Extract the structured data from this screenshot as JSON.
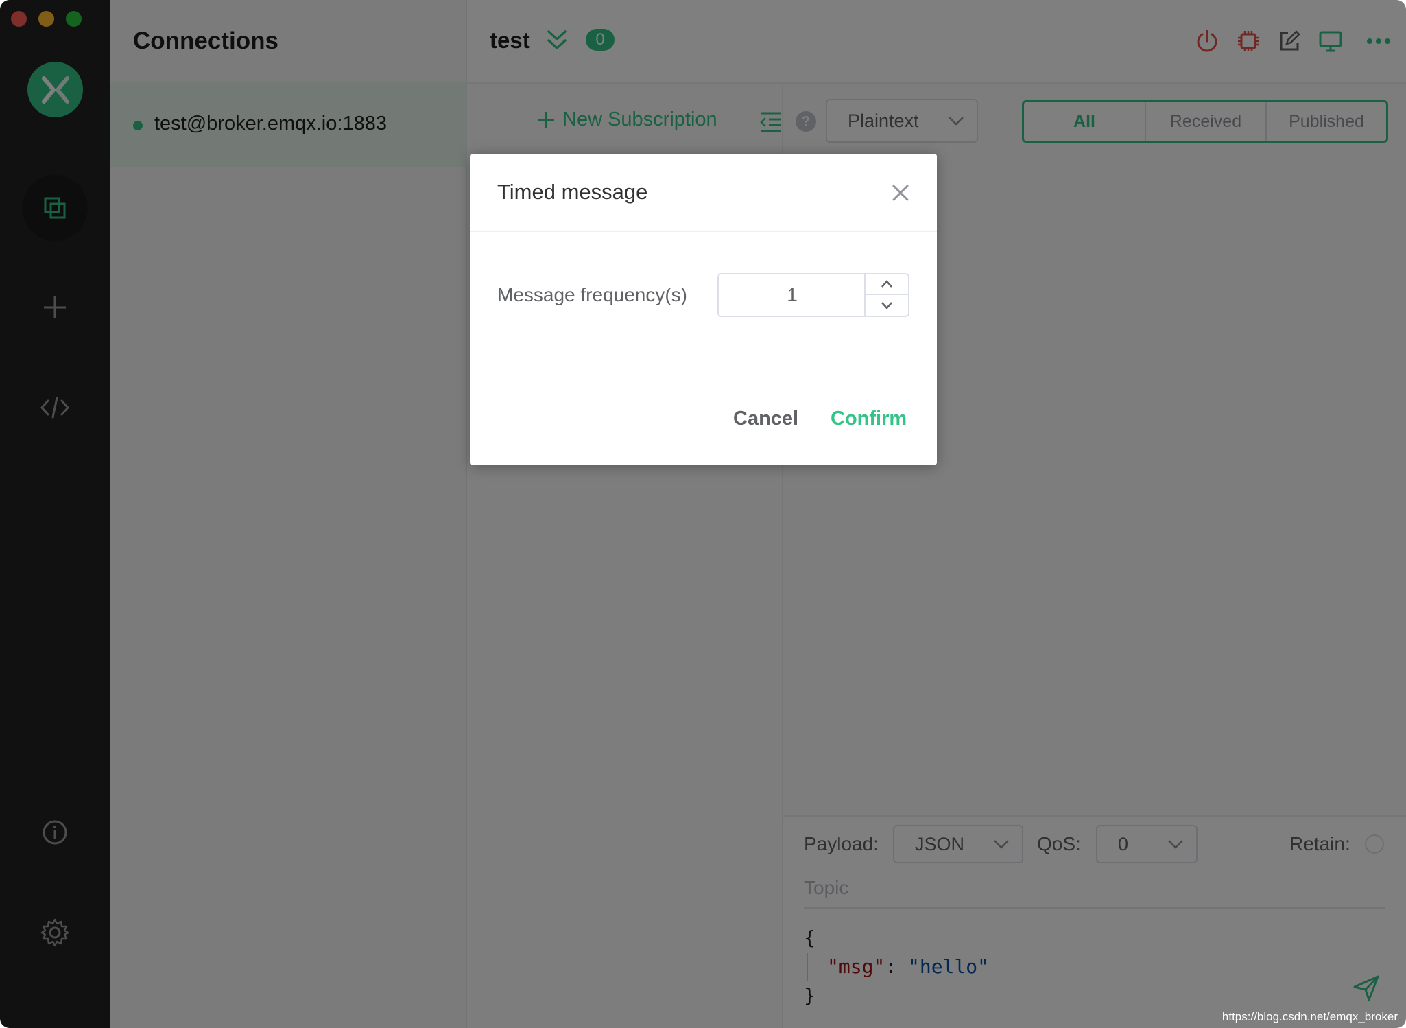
{
  "sidebar": {
    "nav": [
      {
        "icon": "connections-icon",
        "active": true
      },
      {
        "icon": "plus-icon",
        "active": false
      },
      {
        "icon": "code-icon",
        "active": false
      },
      {
        "icon": "info-icon",
        "active": false
      },
      {
        "icon": "gear-icon",
        "active": false
      }
    ]
  },
  "connections": {
    "title": "Connections",
    "items": [
      {
        "name": "test@broker.emqx.io:1883",
        "status": "connected"
      }
    ]
  },
  "header": {
    "title": "test",
    "badge_count": "0"
  },
  "subscriptions": {
    "new_label": "New Subscription"
  },
  "messages": {
    "format": "Plaintext",
    "filters": [
      "All",
      "Received",
      "Published"
    ],
    "active_filter": "All"
  },
  "publish": {
    "payload_label": "Payload:",
    "payload_format": "JSON",
    "qos_label": "QoS:",
    "qos_value": "0",
    "retain_label": "Retain:",
    "topic_placeholder": "Topic",
    "code_open": "{",
    "code_key": "\"msg\"",
    "code_colon": ": ",
    "code_value": "\"hello\"",
    "code_close": "}"
  },
  "dialog": {
    "title": "Timed message",
    "field_label": "Message frequency(s)",
    "field_value": "1",
    "cancel_label": "Cancel",
    "confirm_label": "Confirm"
  },
  "watermark": "https://blog.csdn.net/emqx_broker",
  "colors": {
    "accent": "#34c388",
    "danger": "#e0504a",
    "sidebar_bg": "#232323"
  }
}
